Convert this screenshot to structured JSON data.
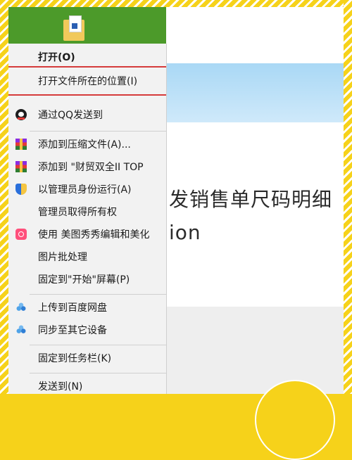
{
  "background": {
    "title_text": "发销售单尺码明细",
    "subtitle_text": "ion"
  },
  "menu": {
    "items": [
      {
        "label": "打开(O)"
      },
      {
        "label": "打开文件所在的位置(I)"
      },
      {
        "label": "通过QQ发送到"
      },
      {
        "label": "添加到压缩文件(A)..."
      },
      {
        "label": "添加到 \"财贸双全II TOP"
      },
      {
        "label": "以管理员身份运行(A)"
      },
      {
        "label": "管理员取得所有权"
      },
      {
        "label": "使用 美图秀秀编辑和美化"
      },
      {
        "label": "图片批处理"
      },
      {
        "label": "固定到\"开始\"屏幕(P)"
      },
      {
        "label": "上传到百度网盘"
      },
      {
        "label": "同步至其它设备"
      },
      {
        "label": "固定到任务栏(K)"
      },
      {
        "label": "发送到(N)"
      }
    ]
  },
  "colors": {
    "accent_yellow": "#f6d21a",
    "highlight_red": "#d53b3b",
    "menu_bg": "#f2f2f2",
    "tile_green": "#4c9a2a"
  }
}
